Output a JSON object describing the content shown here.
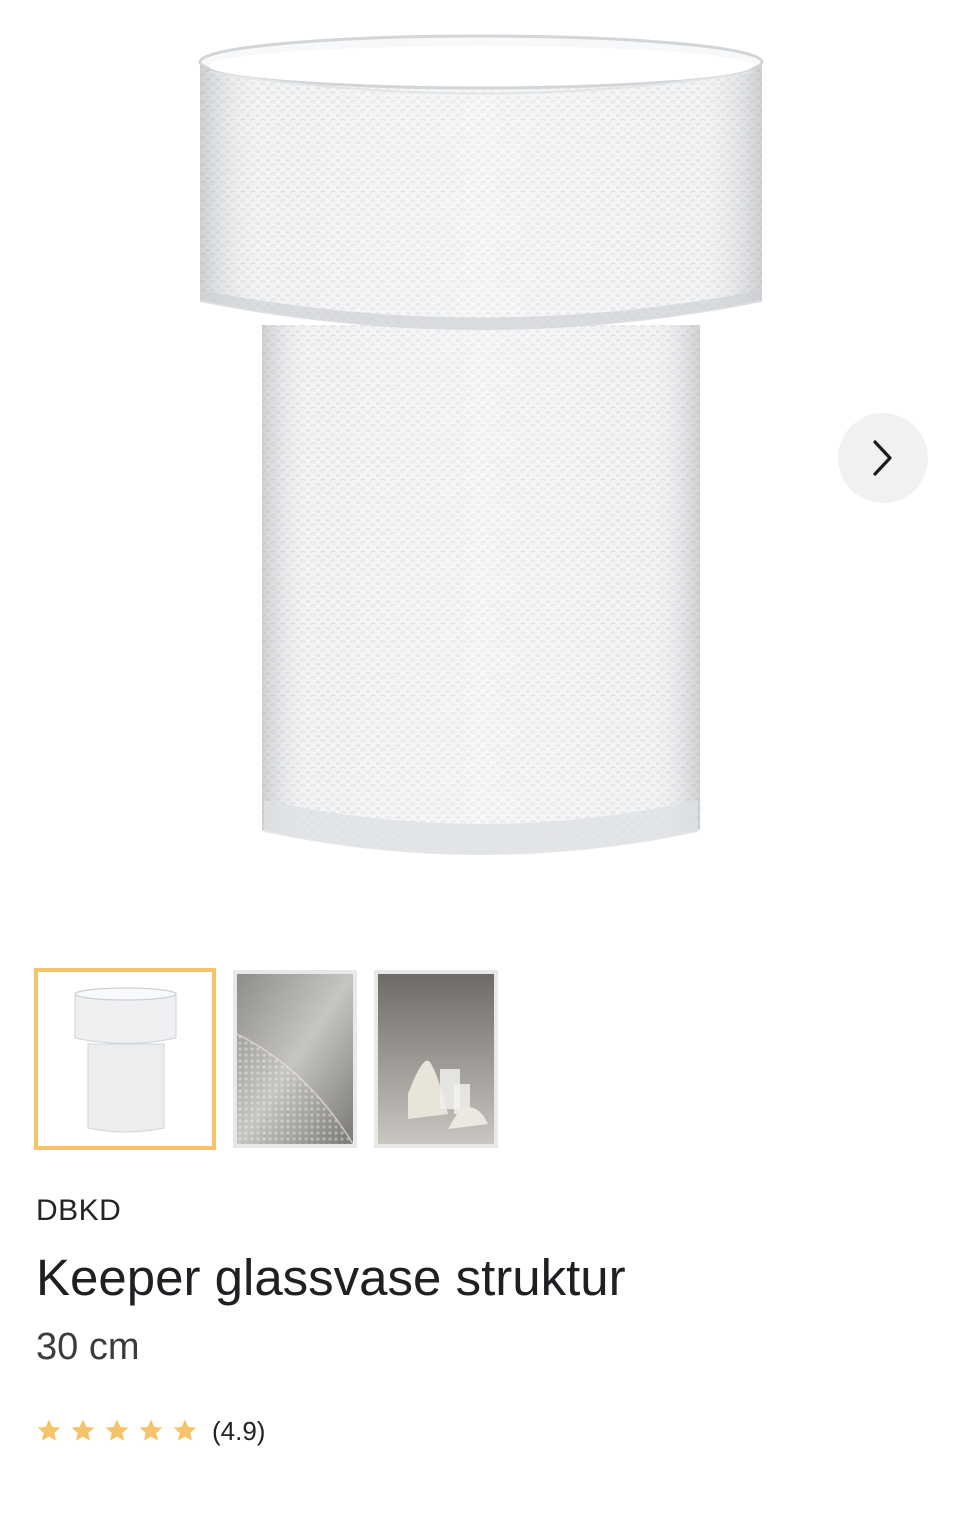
{
  "product": {
    "brand": "DBKD",
    "title": "Keeper glassvase struktur",
    "size": "30 cm",
    "rating": 4.9,
    "rating_label": "(4.9)",
    "rating_max": 5
  },
  "gallery": {
    "image_count": 3,
    "selected_index": 0,
    "next_icon": "chevron-right-icon"
  },
  "colors": {
    "accent": "#f4c36a",
    "star": "#f4c36a",
    "text": "#1e2024"
  }
}
